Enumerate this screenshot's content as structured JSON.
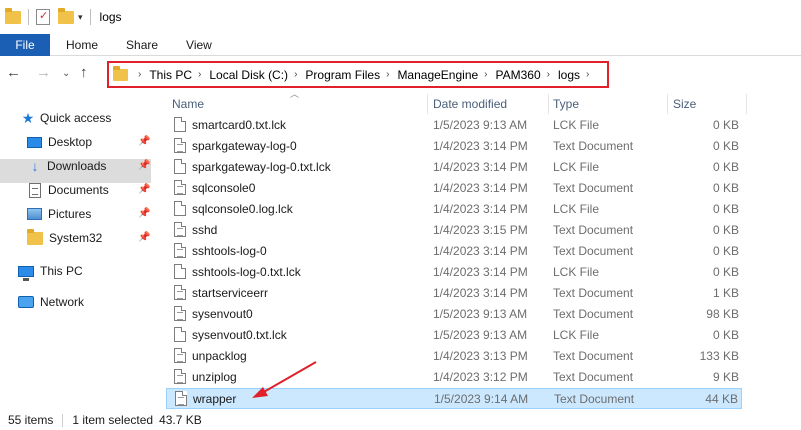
{
  "window": {
    "title": "logs"
  },
  "ribbon": {
    "tabs": [
      "File",
      "Home",
      "Share",
      "View"
    ]
  },
  "address": {
    "crumbs": [
      "This PC",
      "Local Disk (C:)",
      "Program Files",
      "ManageEngine",
      "PAM360",
      "logs"
    ]
  },
  "sidebar": {
    "quick_access": "Quick access",
    "items": [
      {
        "label": "Desktop",
        "icon": "desktop-icon",
        "pinned": true
      },
      {
        "label": "Downloads",
        "icon": "download-arrow-icon",
        "pinned": true
      },
      {
        "label": "Documents",
        "icon": "documents-icon",
        "pinned": true
      },
      {
        "label": "Pictures",
        "icon": "pictures-icon",
        "pinned": true
      },
      {
        "label": "System32",
        "icon": "folder-icon",
        "pinned": true
      }
    ],
    "this_pc": "This PC",
    "network": "Network"
  },
  "columns": {
    "name": "Name",
    "date": "Date modified",
    "type": "Type",
    "size": "Size"
  },
  "files": [
    {
      "name": "smartcard0.txt.lck",
      "date": "1/5/2023 9:13 AM",
      "type": "LCK File",
      "size": "0 KB"
    },
    {
      "name": "sparkgateway-log-0",
      "date": "1/4/2023 3:14 PM",
      "type": "Text Document",
      "size": "0 KB"
    },
    {
      "name": "sparkgateway-log-0.txt.lck",
      "date": "1/4/2023 3:14 PM",
      "type": "LCK File",
      "size": "0 KB"
    },
    {
      "name": "sqlconsole0",
      "date": "1/4/2023 3:14 PM",
      "type": "Text Document",
      "size": "0 KB"
    },
    {
      "name": "sqlconsole0.log.lck",
      "date": "1/4/2023 3:14 PM",
      "type": "LCK File",
      "size": "0 KB"
    },
    {
      "name": "sshd",
      "date": "1/4/2023 3:15 PM",
      "type": "Text Document",
      "size": "0 KB"
    },
    {
      "name": "sshtools-log-0",
      "date": "1/4/2023 3:14 PM",
      "type": "Text Document",
      "size": "0 KB"
    },
    {
      "name": "sshtools-log-0.txt.lck",
      "date": "1/4/2023 3:14 PM",
      "type": "LCK File",
      "size": "0 KB"
    },
    {
      "name": "startserviceerr",
      "date": "1/4/2023 3:14 PM",
      "type": "Text Document",
      "size": "1 KB"
    },
    {
      "name": "sysenvout0",
      "date": "1/5/2023 9:13 AM",
      "type": "Text Document",
      "size": "98 KB"
    },
    {
      "name": "sysenvout0.txt.lck",
      "date": "1/5/2023 9:13 AM",
      "type": "LCK File",
      "size": "0 KB"
    },
    {
      "name": "unpacklog",
      "date": "1/4/2023 3:13 PM",
      "type": "Text Document",
      "size": "133 KB"
    },
    {
      "name": "unziplog",
      "date": "1/4/2023 3:12 PM",
      "type": "Text Document",
      "size": "9 KB"
    },
    {
      "name": "wrapper",
      "date": "1/5/2023 9:14 AM",
      "type": "Text Document",
      "size": "44 KB",
      "selected": true
    }
  ],
  "status": {
    "items": "55 items",
    "selected": "1 item selected",
    "size": "43.7 KB"
  },
  "colors": {
    "accent": "#1a5fb4",
    "highlight_box": "#e0202a",
    "selection": "#cce8ff",
    "arrow": "#e0202a"
  }
}
